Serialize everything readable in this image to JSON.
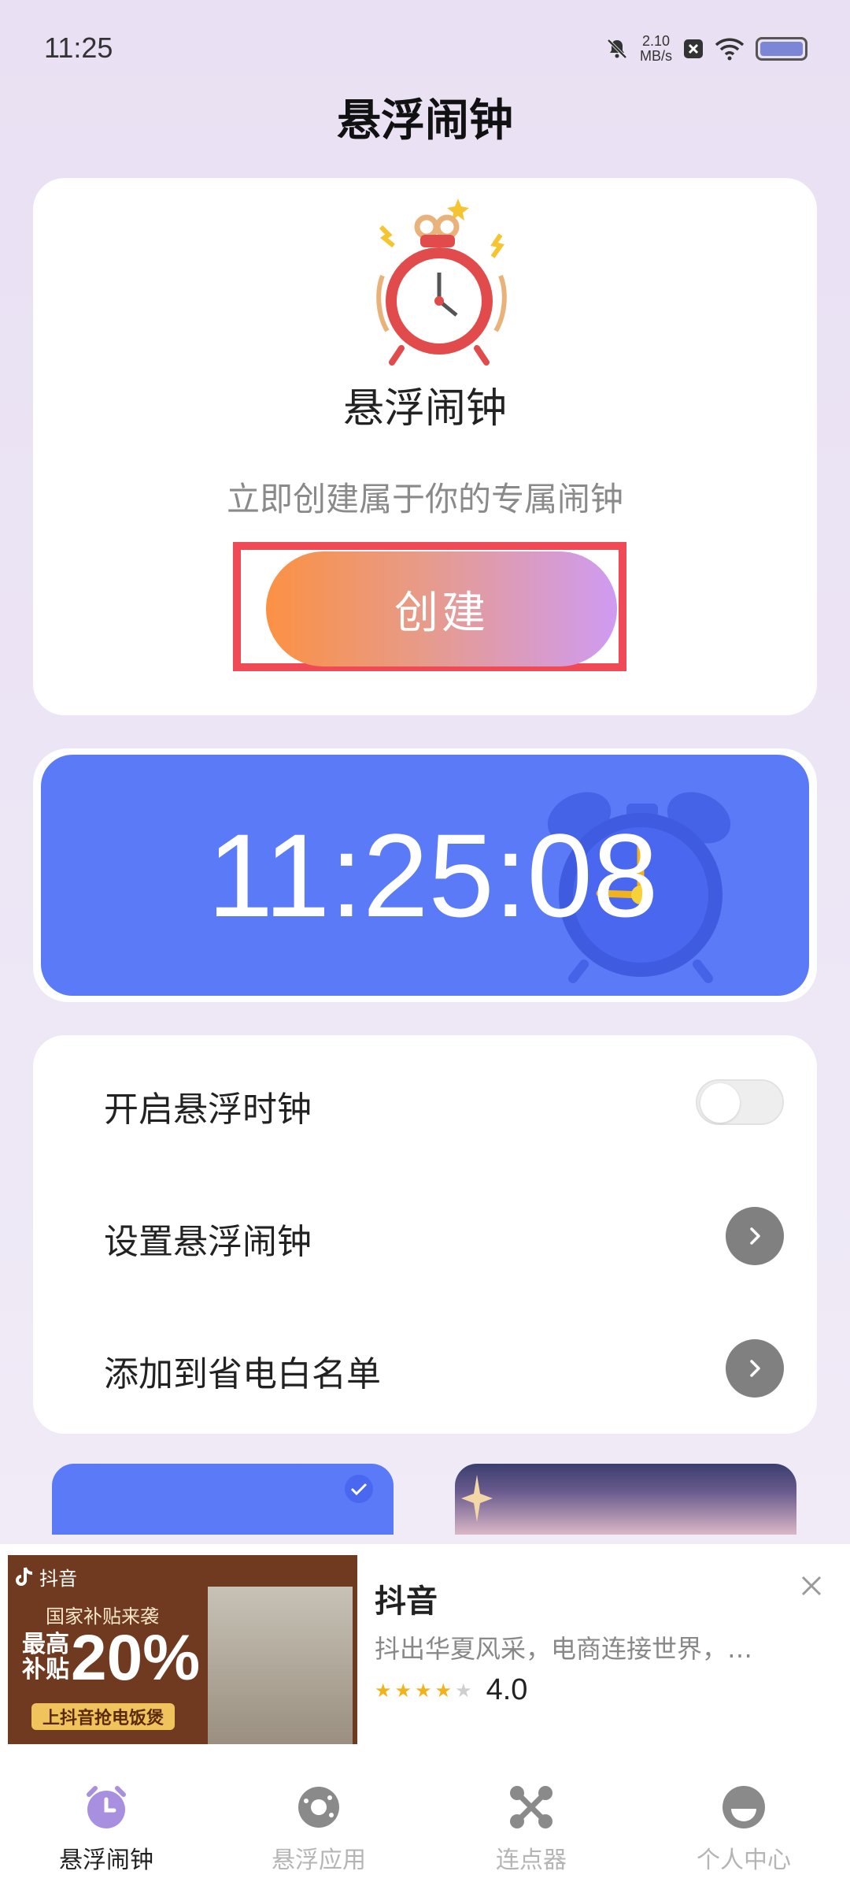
{
  "status_bar": {
    "time": "11:25",
    "net_speed_value": "2.10",
    "net_speed_unit": "MB/s"
  },
  "header": {
    "title": "悬浮闹钟"
  },
  "create_card": {
    "title": "悬浮闹钟",
    "subtitle": "立即创建属于你的专属闹钟",
    "button_label": "创建"
  },
  "clock_card": {
    "time": "11:25:08",
    "color": "#5a7af7"
  },
  "settings": {
    "items": [
      {
        "label": "开启悬浮时钟",
        "control": "toggle",
        "on": false
      },
      {
        "label": "设置悬浮闹钟",
        "control": "arrow"
      },
      {
        "label": "添加到省电白名单",
        "control": "arrow"
      }
    ]
  },
  "ad": {
    "brand": "抖音",
    "promo_line": "国家补贴来袭",
    "promo_prefix": "最高补贴",
    "promo_percent": "20%",
    "cta": "上抖音抢电饭煲",
    "app_name": "抖音",
    "description": "抖出华夏风采，电商连接世界，…",
    "rating": "4.0",
    "stars_filled": 4,
    "stars_total": 5
  },
  "bottom_nav": {
    "items": [
      {
        "label": "悬浮闹钟",
        "icon": "alarm-clock-icon",
        "active": true
      },
      {
        "label": "悬浮应用",
        "icon": "donut-icon",
        "active": false
      },
      {
        "label": "连点器",
        "icon": "connector-icon",
        "active": false
      },
      {
        "label": "个人中心",
        "icon": "profile-icon",
        "active": false
      }
    ]
  },
  "colors": {
    "accent": "#5a7af7",
    "nav_active": "#a98fe0",
    "highlight_border": "#ef4a55"
  }
}
